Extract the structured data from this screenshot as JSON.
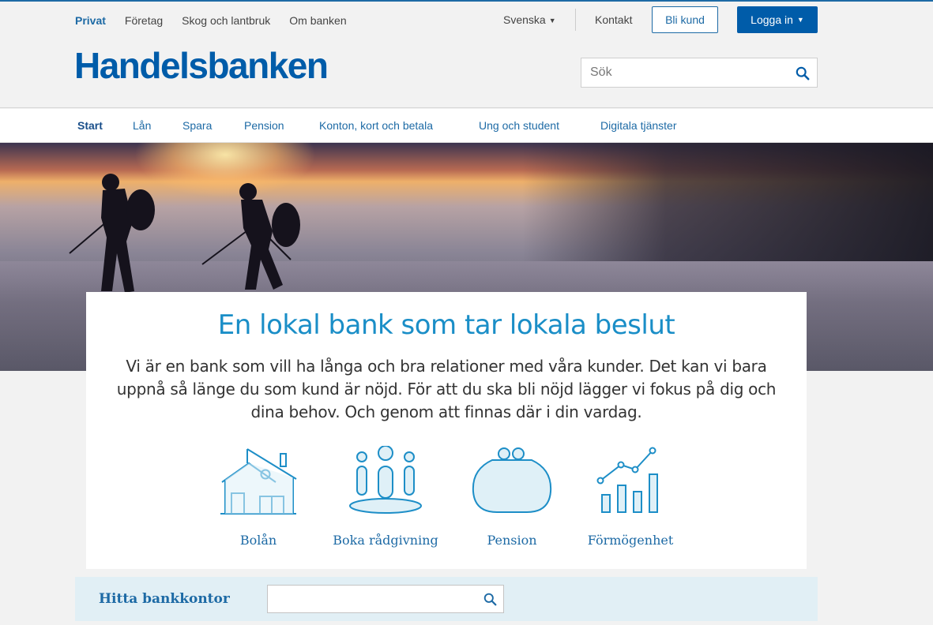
{
  "top_nav": {
    "segments": [
      "Privat",
      "Företag",
      "Skog och lantbruk",
      "Om banken"
    ],
    "language": "Svenska",
    "contact": "Kontakt",
    "become_customer": "Bli kund",
    "login": "Logga in"
  },
  "brand": {
    "name": "Handelsbanken"
  },
  "search": {
    "placeholder": "Sök"
  },
  "main_nav": [
    "Start",
    "Lån",
    "Spara",
    "Pension",
    "Konton, kort och betala",
    "Ung och student",
    "Digitala tjänster"
  ],
  "hero_card": {
    "title": "En lokal bank som tar lokala beslut",
    "body": "Vi är en bank som vill ha långa och bra relationer med våra kunder. Det kan vi bara uppnå så länge du som kund är nöjd. För att du ska bli nöjd lägger vi fokus på dig och dina behov. Och genom att finnas där i din vardag."
  },
  "quick_links": [
    {
      "label": "Bolån",
      "icon": "house-icon"
    },
    {
      "label": "Boka rådgivning",
      "icon": "people-icon"
    },
    {
      "label": "Pension",
      "icon": "purse-icon"
    },
    {
      "label": "Förmögenhet",
      "icon": "growth-chart-icon"
    }
  ],
  "branch_finder": {
    "title": "Hitta bankkontor",
    "value": ""
  },
  "colors": {
    "brand": "#005ca9",
    "accent": "#1a8ec7",
    "finder_bg": "#e1eff5",
    "icon_fill": "#dff0f7"
  }
}
